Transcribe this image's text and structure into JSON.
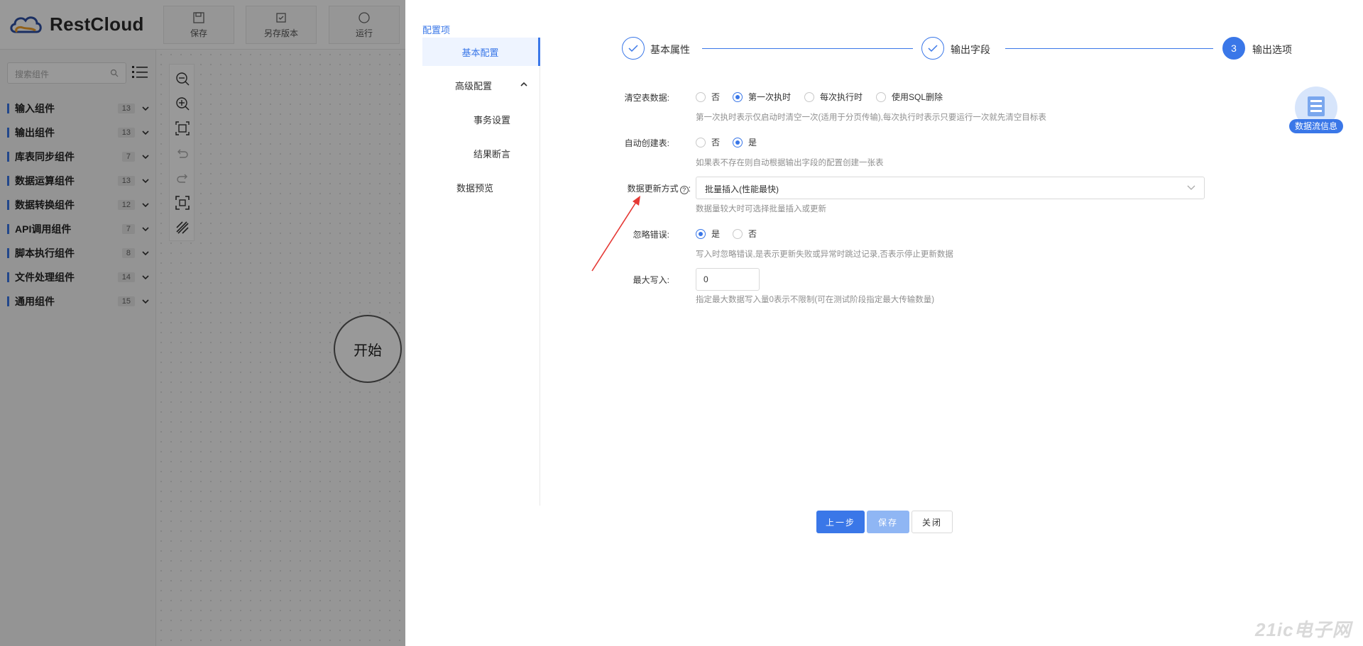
{
  "app": {
    "brand": "RestCloud"
  },
  "toolbar": {
    "save": "保存",
    "save_version": "另存版本",
    "run": "运行"
  },
  "sidebar": {
    "search_placeholder": "搜索组件",
    "categories": [
      {
        "label": "输入组件",
        "count": "13"
      },
      {
        "label": "输出组件",
        "count": "13"
      },
      {
        "label": "库表同步组件",
        "count": "7"
      },
      {
        "label": "数据运算组件",
        "count": "13"
      },
      {
        "label": "数据转换组件",
        "count": "12"
      },
      {
        "label": "API调用组件",
        "count": "7"
      },
      {
        "label": "脚本执行组件",
        "count": "8"
      },
      {
        "label": "文件处理组件",
        "count": "14"
      },
      {
        "label": "通用组件",
        "count": "15"
      }
    ]
  },
  "canvas": {
    "start_node": "开始"
  },
  "drawer": {
    "title": "配置项",
    "menu": {
      "basic": "基本配置",
      "advanced": "高级配置",
      "transaction": "事务设置",
      "assertion": "结果断言",
      "preview": "数据预览"
    },
    "steps": {
      "s1": "基本属性",
      "s2": "输出字段",
      "s3_num": "3",
      "s3": "输出选项"
    },
    "form": {
      "clear_label": "清空表数据:",
      "clear_options": [
        "否",
        "第一次执时",
        "每次执行时",
        "使用SQL删除"
      ],
      "clear_hint": "第一次执时表示仅启动时清空一次(适用于分页传输),每次执行时表示只要运行一次就先清空目标表",
      "autocreate_label": "自动创建表:",
      "autocreate_options": [
        "否",
        "是"
      ],
      "autocreate_hint": "如果表不存在则自动根据输出字段的配置创建一张表",
      "update_label": "数据更新方式",
      "update_value": "批量插入(性能最快)",
      "update_hint": "数据量较大时可选择批量插入或更新",
      "ignore_label": "忽略错误:",
      "ignore_options": [
        "是",
        "否"
      ],
      "ignore_hint": "写入时忽略错误,是表示更新失败或异常时跳过记录,否表示停止更新数据",
      "max_label": "最大写入:",
      "max_value": "0",
      "max_hint": "指定最大数据写入量0表示不限制(可在测试阶段指定最大传输数量)"
    },
    "buttons": {
      "prev": "上一步",
      "save": "保存",
      "close": "关闭"
    },
    "flow_info": "数据流信息"
  },
  "watermark": "21ic电子网"
}
